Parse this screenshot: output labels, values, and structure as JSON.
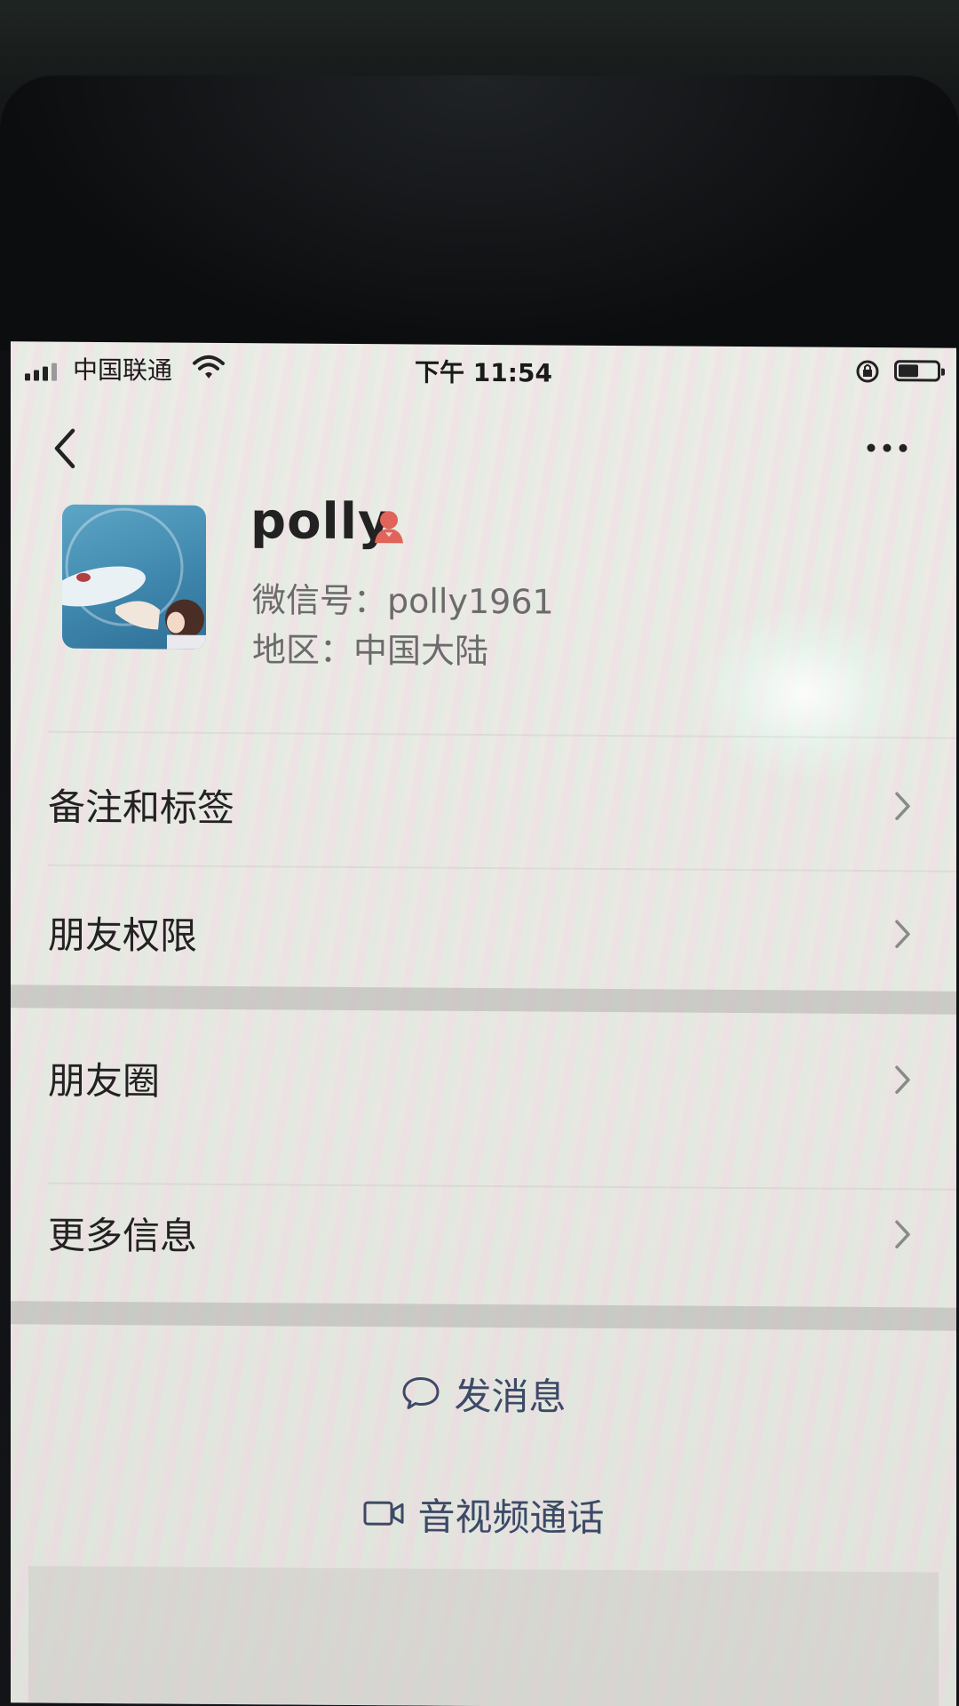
{
  "status_bar": {
    "carrier": "中国联通",
    "time": "下午 11:54",
    "battery_level": 0.55
  },
  "nav": {
    "back_icon": "chevron-left-icon",
    "more_icon": "ellipsis-icon"
  },
  "profile": {
    "name": "polly",
    "gender_icon": "female-icon",
    "wechat_id": "微信号：polly1961",
    "region": "地区：中国大陆"
  },
  "menu": {
    "items": [
      {
        "label": "备注和标签"
      },
      {
        "label": "朋友权限"
      },
      {
        "label": "朋友圈"
      },
      {
        "label": "更多信息"
      }
    ]
  },
  "actions": {
    "message": "发消息",
    "call": "音视频通话"
  },
  "colors": {
    "accent": "#3c4a66",
    "gender_female": "#e0645a"
  }
}
